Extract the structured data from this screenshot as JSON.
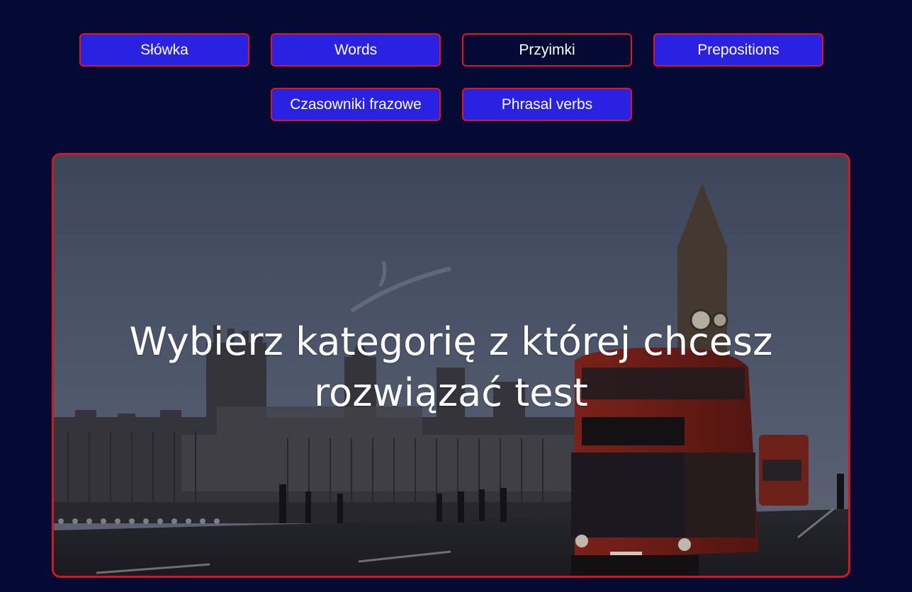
{
  "nav": {
    "buttons": [
      {
        "label": "Słówka",
        "style": "filled"
      },
      {
        "label": "Words",
        "style": "filled"
      },
      {
        "label": "Przyimki",
        "style": "outline"
      },
      {
        "label": "Prepositions",
        "style": "filled"
      },
      {
        "label": "Czasowniki frazowe",
        "style": "filled"
      },
      {
        "label": "Phrasal verbs",
        "style": "filled"
      }
    ]
  },
  "hero": {
    "title_line_1": "Wybierz kategorię z której chcesz",
    "title_line_2": "rozwiązać test",
    "image": "london-westminster-bus-photo"
  },
  "colors": {
    "background": "#040a33",
    "button_fill": "#2a22e3",
    "border_accent": "#e3141c",
    "text": "#ffffff"
  }
}
